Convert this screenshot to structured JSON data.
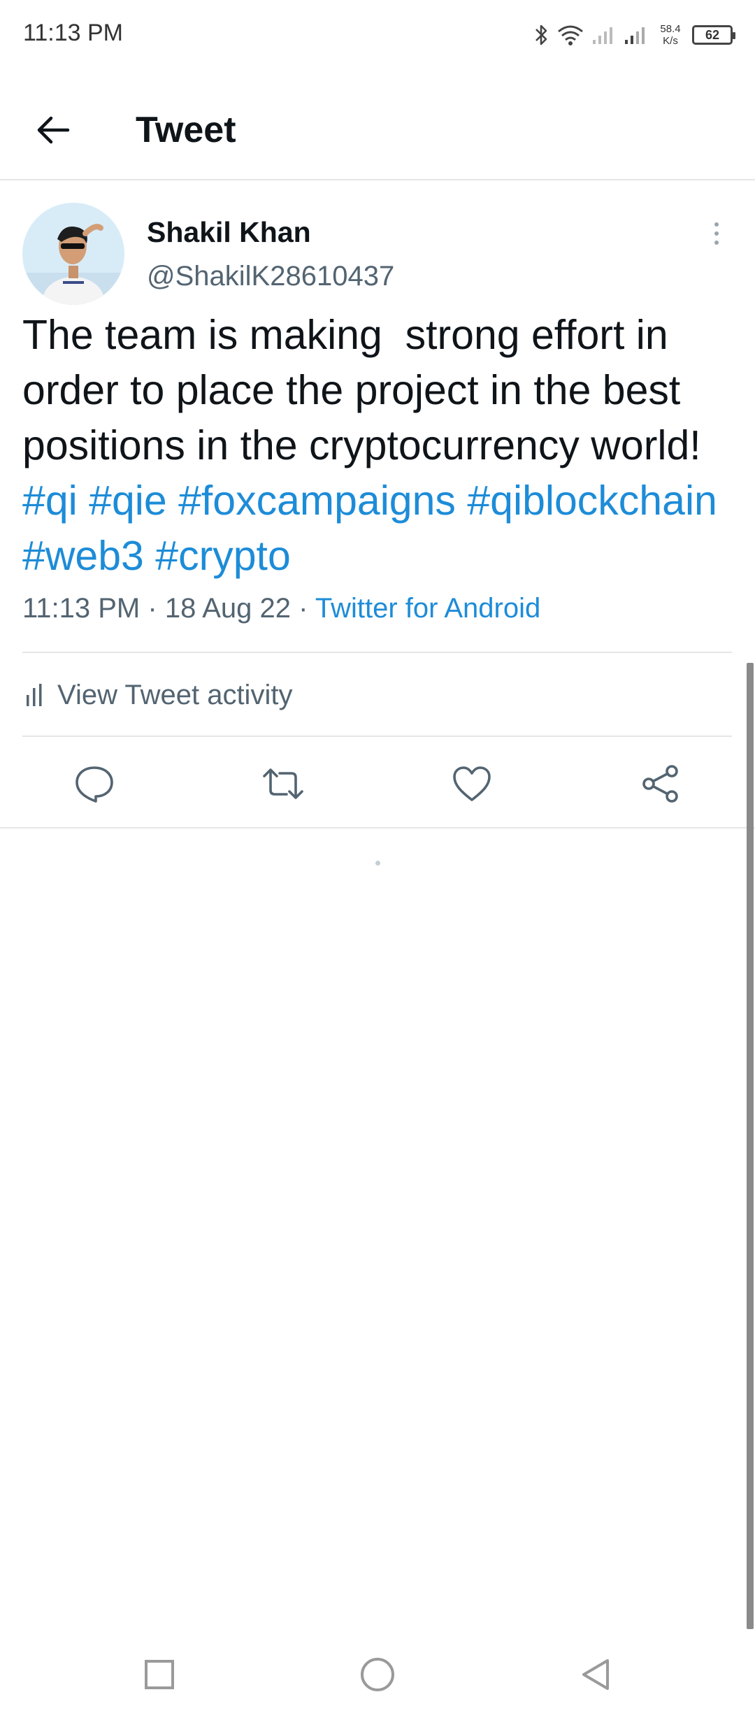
{
  "status_bar": {
    "time": "11:13 PM",
    "net_speed_value": "58.4",
    "net_speed_unit": "K/s",
    "battery": "62",
    "icons": [
      "bluetooth-icon",
      "wifi-icon",
      "signal-icon",
      "signal-icon",
      "battery-icon"
    ]
  },
  "header": {
    "title": "Tweet",
    "back_icon": "arrow-left-icon"
  },
  "tweet": {
    "author_name": "Shakil Khan",
    "author_handle": "@ShakilK28610437",
    "text_plain": "The team is making  strong effort in order to place the project in the best positions in the cryptocurrency world! ",
    "hashtags": [
      "#qi",
      "#qie",
      "#foxcampaigns",
      "#qiblockchain",
      "#web3",
      "#crypto"
    ],
    "time": "11:13 PM",
    "date": "18 Aug 22",
    "separator": "·",
    "source": "Twitter for Android"
  },
  "activity": {
    "label": "View Tweet activity",
    "icon": "bar-chart-icon"
  },
  "actions": {
    "reply_icon": "reply-icon",
    "retweet_icon": "retweet-icon",
    "like_icon": "heart-icon",
    "share_icon": "share-icon"
  },
  "nav_bar": {
    "recent_icon": "square-icon",
    "home_icon": "circle-icon",
    "back_icon": "triangle-back-icon"
  },
  "colors": {
    "accent": "#1d9bf0",
    "text_primary": "#0f1419",
    "text_secondary": "#536471",
    "divider": "#e6e6e6"
  }
}
